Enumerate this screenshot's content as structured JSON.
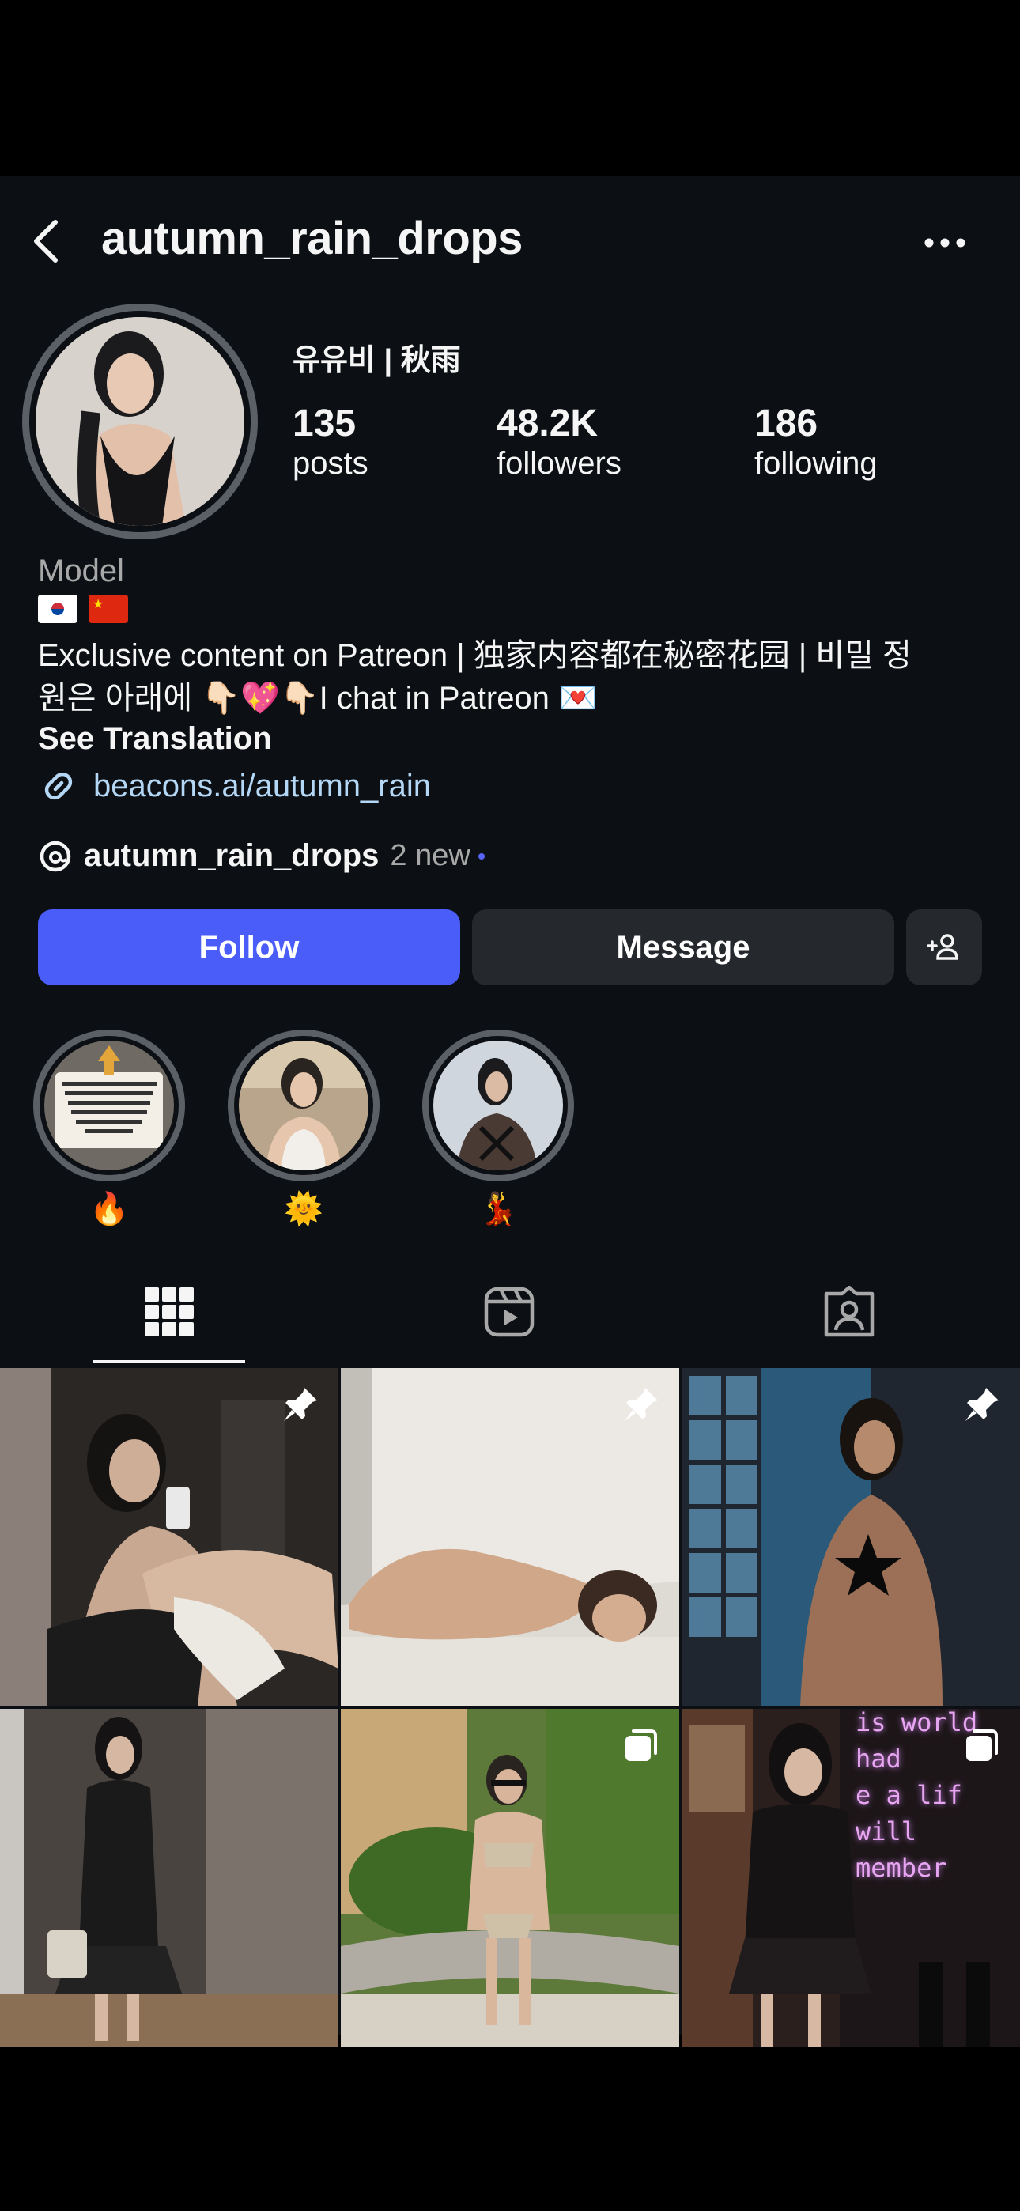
{
  "header": {
    "username": "autumn_rain_drops"
  },
  "profile": {
    "display_name": "유유비 | 秋雨",
    "stats": [
      {
        "value": "135",
        "label": "posts"
      },
      {
        "value": "48.2K",
        "label": "followers"
      },
      {
        "value": "186",
        "label": "following"
      }
    ],
    "category": "Model",
    "bio_line1": "Exclusive content on Patreon | 独家内容都在秘密花园 | 비밀 정",
    "bio_line2": "원은 아래에 👇🏻💖👇🏻I chat in Patreon 💌",
    "see_translation": "See Translation",
    "link": "beacons.ai/autumn_rain",
    "threads_name": "autumn_rain_drops",
    "threads_new": "2 new"
  },
  "actions": {
    "follow": "Follow",
    "message": "Message"
  },
  "highlights": [
    {
      "emoji": "🔥",
      "thumb_text": "真的非常感谢你一直以来支持我的，我觉得你们的陪伴..."
    },
    {
      "emoji": "🌞"
    },
    {
      "emoji": "💃"
    }
  ],
  "grid": {
    "posts": [
      {
        "badge": "pin-icon"
      },
      {
        "badge": "pin-icon"
      },
      {
        "badge": "pin-icon"
      },
      {
        "badge": ""
      },
      {
        "badge": "carousel-icon"
      },
      {
        "badge": "carousel-icon",
        "overlay_text": "is world\nhad\ne a lif\nwill\nmember"
      }
    ]
  },
  "colors": {
    "background": "#0c1014",
    "follow_button": "#4a5df9",
    "secondary_button": "#25292e",
    "link": "#b3d7f5",
    "muted_text": "#a8a8a8"
  }
}
